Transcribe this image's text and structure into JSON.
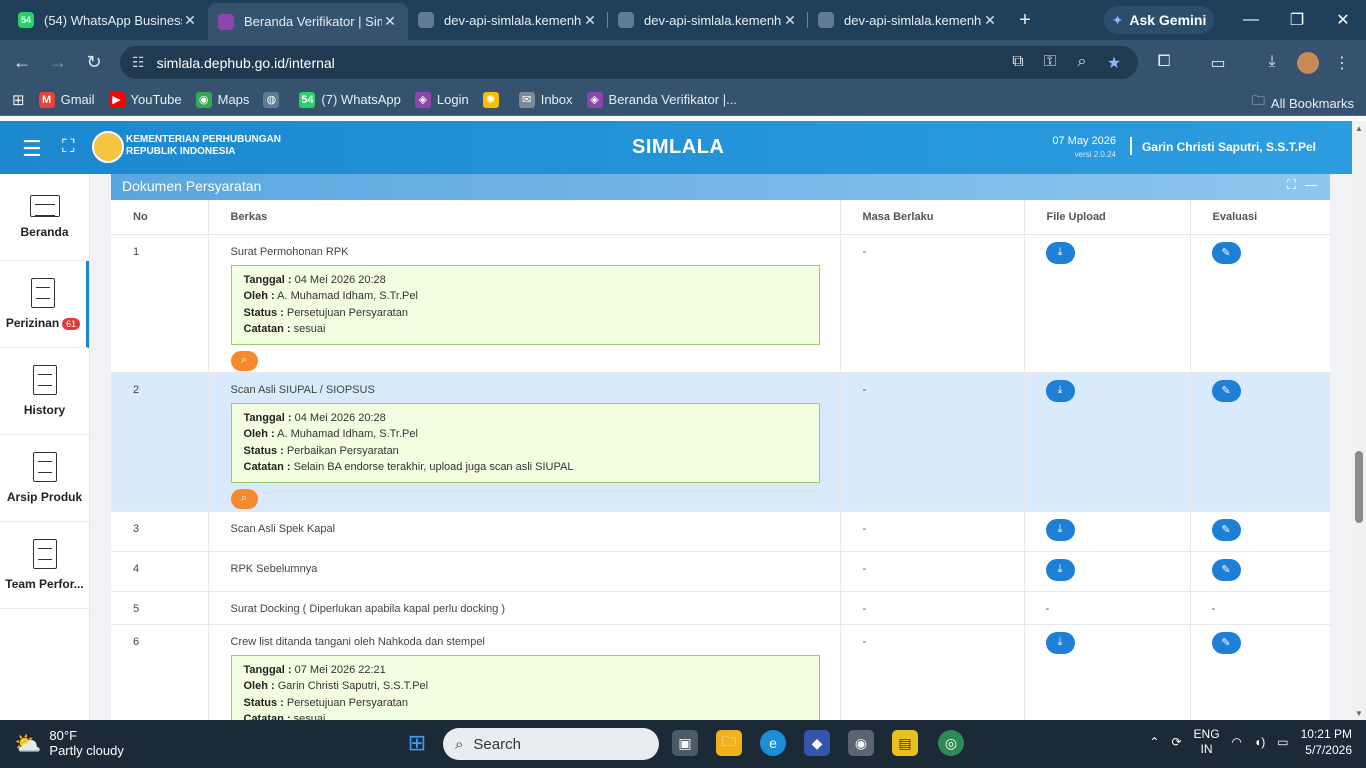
{
  "browser": {
    "tabs": [
      {
        "title": "(54) WhatsApp Business",
        "favicon": "54",
        "active": false
      },
      {
        "title": "Beranda Verifikator | Sim",
        "favicon": "",
        "active": true
      },
      {
        "title": "dev-api-simlala.kemenhu",
        "favicon": "",
        "active": false
      },
      {
        "title": "dev-api-simlala.kemenhu",
        "favicon": "",
        "active": false
      },
      {
        "title": "dev-api-simlala.kemenhu",
        "favicon": "",
        "active": false
      }
    ],
    "gemini_label": "Ask Gemini",
    "url": "simlala.dephub.go.id/internal",
    "bookmarks": [
      {
        "label": "Gmail",
        "icon": "M",
        "color": "#ea4335"
      },
      {
        "label": "YouTube",
        "icon": "▶",
        "color": "#ff0000"
      },
      {
        "label": "Maps",
        "icon": "◉",
        "color": "#34a853"
      },
      {
        "label": "",
        "icon": "◍",
        "color": "#5f7a93"
      },
      {
        "label": "(7) WhatsApp",
        "icon": "54",
        "color": "#25d366"
      },
      {
        "label": "Login",
        "icon": "◈",
        "color": "#8e44ad"
      },
      {
        "label": "",
        "icon": "✺",
        "color": "#fbbc05"
      },
      {
        "label": "Inbox",
        "icon": "✉",
        "color": "#7d8b99"
      },
      {
        "label": "Beranda Verifikator |...",
        "icon": "◈",
        "color": "#8e44ad"
      }
    ],
    "all_bookmarks_label": "All Bookmarks"
  },
  "header": {
    "ministry_line1": "KEMENTERIAN PERHUBUNGAN",
    "ministry_line2": "REPUBLIK INDONESIA",
    "app_title": "SIMLALA",
    "date": "07 May 2026",
    "version": "versi 2.0.24",
    "user": "Garin Christi Saputri, S.S.T.Pel"
  },
  "sidebar": {
    "items": [
      {
        "label": "Beranda",
        "badge": "",
        "icon": "monitor-icon"
      },
      {
        "label": "Perizinan",
        "badge": "61",
        "icon": "document-icon"
      },
      {
        "label": "History",
        "badge": "",
        "icon": "document-icon"
      },
      {
        "label": "Arsip Produk",
        "badge": "",
        "icon": "document-icon"
      },
      {
        "label": "Team Perfor...",
        "badge": "",
        "icon": "document-icon"
      }
    ]
  },
  "panel": {
    "title": "Dokumen Persyaratan",
    "columns": [
      "No",
      "Berkas",
      "Masa Berlaku",
      "File Upload",
      "Evaluasi"
    ],
    "labels": {
      "tanggal": "Tanggal :",
      "oleh": "Oleh :",
      "status": "Status :",
      "catatan": "Catatan :"
    },
    "rows": [
      {
        "no": "1",
        "berkas": "Surat Permohonan RPK",
        "masa": "-",
        "file_upload": "download",
        "evaluasi": "edit",
        "note": {
          "tanggal": "04 Mei 2026 20:28",
          "oleh": "A. Muhamad Idham, S.Tr.Pel",
          "status": "Persetujuan Persyaratan",
          "catatan": "sesuai"
        }
      },
      {
        "no": "2",
        "berkas": "Scan Asli SIUPAL / SIOPSUS",
        "masa": "-",
        "file_upload": "download",
        "evaluasi": "edit",
        "note": {
          "tanggal": "04 Mei 2026 20:28",
          "oleh": "A. Muhamad Idham, S.Tr.Pel",
          "status": "Perbaikan Persyaratan",
          "catatan": "Selain BA endorse terakhir, upload juga scan asli SIUPAL"
        }
      },
      {
        "no": "3",
        "berkas": "Scan Asli Spek Kapal",
        "masa": "-",
        "file_upload": "download",
        "evaluasi": "edit",
        "note": null
      },
      {
        "no": "4",
        "berkas": "RPK Sebelumnya",
        "masa": "-",
        "file_upload": "download",
        "evaluasi": "edit",
        "note": null
      },
      {
        "no": "5",
        "berkas": "Surat Docking ( Diperlukan apabila kapal perlu docking )",
        "masa": "-",
        "file_upload": "-",
        "evaluasi": "-",
        "note": null
      },
      {
        "no": "6",
        "berkas": "Crew list ditanda tangani oleh Nahkoda dan stempel",
        "masa": "-",
        "file_upload": "download",
        "evaluasi": "edit",
        "note": {
          "tanggal": "07 Mei 2026 22:21",
          "oleh": "Garin Christi Saputri, S.S.T.Pel",
          "status": "Persetujuan Persyaratan",
          "catatan": "sesuai"
        }
      }
    ]
  },
  "taskbar": {
    "temperature": "80°F",
    "weather": "Partly cloudy",
    "search_placeholder": "Search",
    "lang1": "ENG",
    "lang2": "IN",
    "time": "10:21 PM",
    "date": "5/7/2026"
  }
}
